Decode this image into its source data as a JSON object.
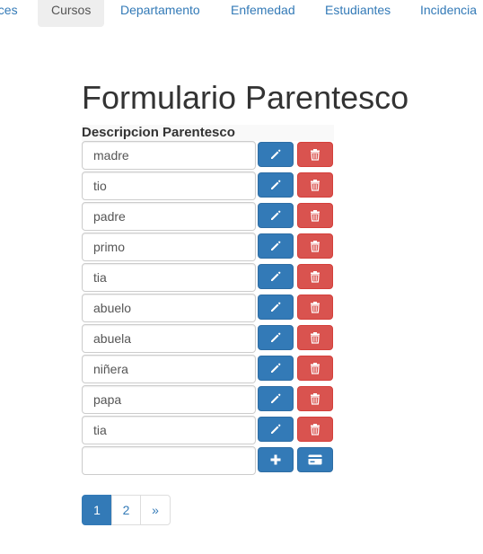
{
  "nav": {
    "items": [
      {
        "label": "nces"
      },
      {
        "label": "Cursos"
      },
      {
        "label": "Departamento"
      },
      {
        "label": "Enfemedad"
      },
      {
        "label": "Estudiantes"
      },
      {
        "label": "Incidencia"
      }
    ],
    "active_index": 1
  },
  "page": {
    "title": "Formulario Parentesco"
  },
  "table": {
    "column_header": "Descripcion Parentesco",
    "rows": [
      {
        "value": "madre"
      },
      {
        "value": "tio"
      },
      {
        "value": "padre"
      },
      {
        "value": "primo"
      },
      {
        "value": "tia"
      },
      {
        "value": "abuelo"
      },
      {
        "value": "abuela"
      },
      {
        "value": "niñera"
      },
      {
        "value": "papa"
      },
      {
        "value": "tia"
      }
    ],
    "new_row": {
      "value": "",
      "placeholder": ""
    },
    "icons": {
      "edit": "pencil-icon",
      "delete": "trash-icon",
      "add": "plus-icon",
      "save": "credit-card-icon"
    }
  },
  "pagination": {
    "pages": [
      "1",
      "2"
    ],
    "next": "»",
    "active_page": "1"
  },
  "colors": {
    "primary": "#337ab7",
    "danger": "#d9534f",
    "text": "#333333"
  }
}
